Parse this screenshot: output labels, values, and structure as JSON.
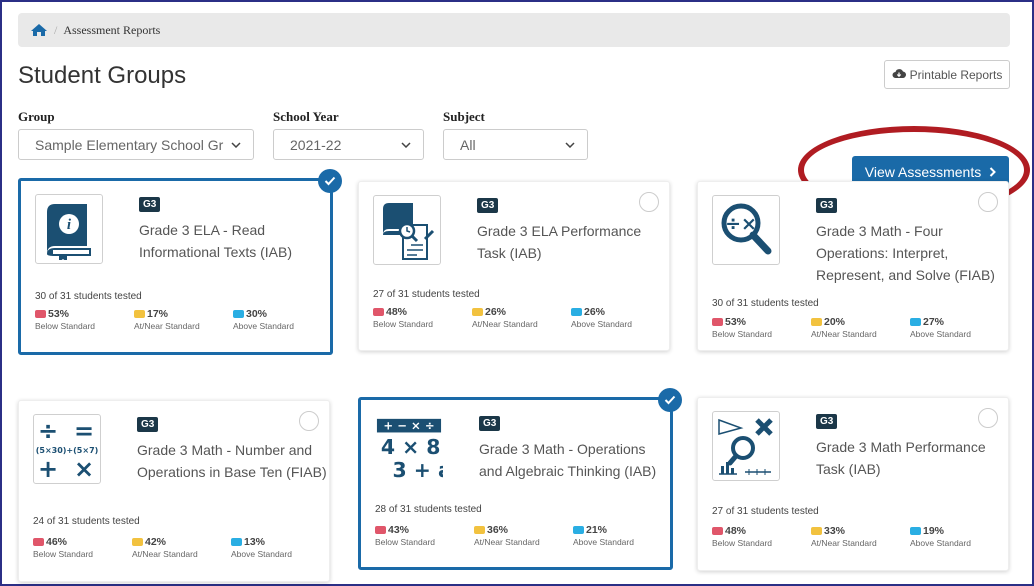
{
  "breadcrumb": {
    "current": "Assessment Reports"
  },
  "page": {
    "title": "Student Groups"
  },
  "toolbar": {
    "printable_label": "Printable Reports"
  },
  "filters": {
    "group": {
      "label": "Group",
      "value": "Sample Elementary School Gr"
    },
    "school_year": {
      "label": "School Year",
      "value": "2021-22"
    },
    "subject": {
      "label": "Subject",
      "value": "All"
    }
  },
  "view_button": {
    "label": "View Assessments"
  },
  "colors": {
    "below": "#e0566a",
    "near": "#f2c23f",
    "above": "#2aaee3",
    "primary": "#1a6aa8",
    "badge": "#1b3748"
  },
  "cards": [
    {
      "grade": "G3",
      "title": "Grade 3 ELA - Read Informational Texts (IAB)",
      "icon": "informational-book-icon",
      "selected": true,
      "tested": "30 of 31 students tested",
      "below": "53%",
      "near": "17%",
      "above": "30%"
    },
    {
      "grade": "G3",
      "title": "Grade 3 ELA Performance Task (IAB)",
      "icon": "performance-task-icon",
      "selected": false,
      "tested": "27 of 31 students tested",
      "below": "48%",
      "near": "26%",
      "above": "26%"
    },
    {
      "grade": "G3",
      "title": "Grade 3 Math - Four Operations: Interpret, Represent, and Solve (FIAB)",
      "icon": "four-operations-magnifier-icon",
      "selected": false,
      "tested": "30 of 31 students tested",
      "below": "53%",
      "near": "20%",
      "above": "27%"
    },
    {
      "grade": "G3",
      "title": "Grade 3 Math - Number and Operations in Base Ten (FIAB)",
      "icon": "math-operators-icon",
      "selected": false,
      "tested": "24 of 31 students tested",
      "below": "46%",
      "near": "42%",
      "above": "13%"
    },
    {
      "grade": "G3",
      "title": "Grade 3 Math - Operations and Algebraic Thinking (IAB)",
      "icon": "algebra-icon",
      "selected": true,
      "tested": "28 of 31 students tested",
      "below": "43%",
      "near": "36%",
      "above": "21%"
    },
    {
      "grade": "G3",
      "title": "Grade 3 Math Performance Task (IAB)",
      "icon": "math-performance-magnifier-icon",
      "selected": false,
      "tested": "27 of 31 students tested",
      "below": "48%",
      "near": "33%",
      "above": "19%"
    }
  ],
  "stat_labels": {
    "below": "Below Standard",
    "near": "At/Near Standard",
    "above": "Above Standard"
  },
  "icon_text": {
    "card3": {
      "op_top": "÷",
      "op_right": "=",
      "expr": "(5×30)+(5×7)",
      "op_bl": "+",
      "op_br": "×"
    },
    "card4": {
      "ops": "+ − × ÷",
      "line1": "4 × 8",
      "line2": "3 + a"
    }
  }
}
